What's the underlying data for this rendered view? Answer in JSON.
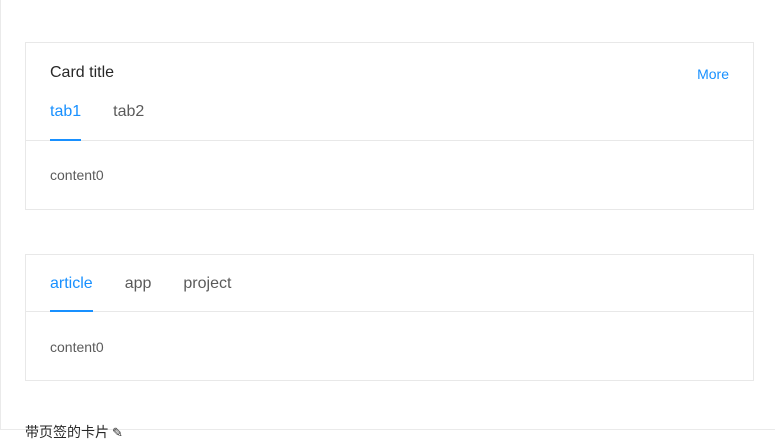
{
  "card1": {
    "title": "Card title",
    "extra": "More",
    "tabs": [
      {
        "label": "tab1",
        "active": true
      },
      {
        "label": "tab2",
        "active": false
      }
    ],
    "content": "content0"
  },
  "card2": {
    "tabs": [
      {
        "label": "article",
        "active": true
      },
      {
        "label": "app",
        "active": false
      },
      {
        "label": "project",
        "active": false
      }
    ],
    "content": "content0"
  },
  "footer": {
    "title": "带页签的卡片",
    "icon": "edit-icon"
  },
  "colors": {
    "accent": "#1890ff",
    "border": "#e8e8e8"
  }
}
